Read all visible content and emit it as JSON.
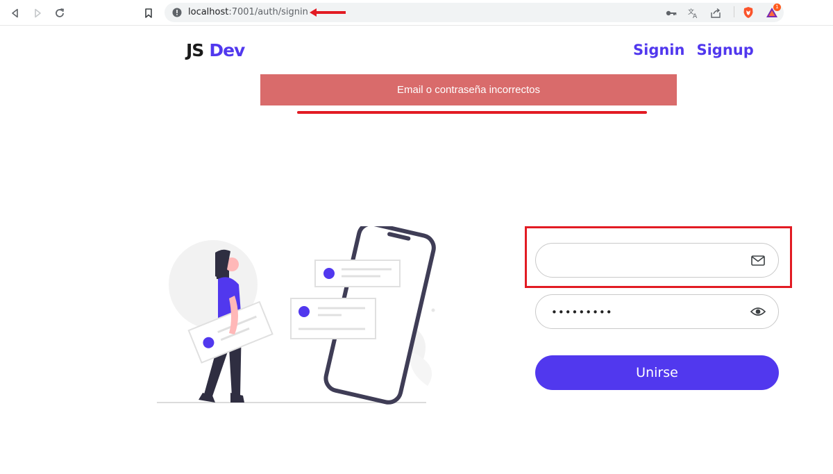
{
  "browser": {
    "url_host": "localhost",
    "url_rest": ":7001/auth/signin",
    "extension_badge": "1",
    "icons": [
      "back-icon",
      "forward-icon",
      "reload-icon",
      "bookmark-icon",
      "info-icon",
      "key-icon",
      "translate-icon",
      "share-icon",
      "brave-shield-icon",
      "brave-rewards-icon"
    ]
  },
  "header": {
    "logo_js": "JS",
    "logo_dev": "Dev",
    "nav": {
      "signin": "Signin",
      "signup": "Signup"
    }
  },
  "alert": {
    "message": "Email o contraseña incorrectos"
  },
  "form": {
    "email": {
      "value": "",
      "placeholder": ""
    },
    "password": {
      "masked_value": "•••••••••"
    },
    "submit_label": "Unirse"
  },
  "colors": {
    "accent": "#5138ee",
    "alert_bg": "#d96b6b",
    "annotation_red": "#e21b23"
  }
}
